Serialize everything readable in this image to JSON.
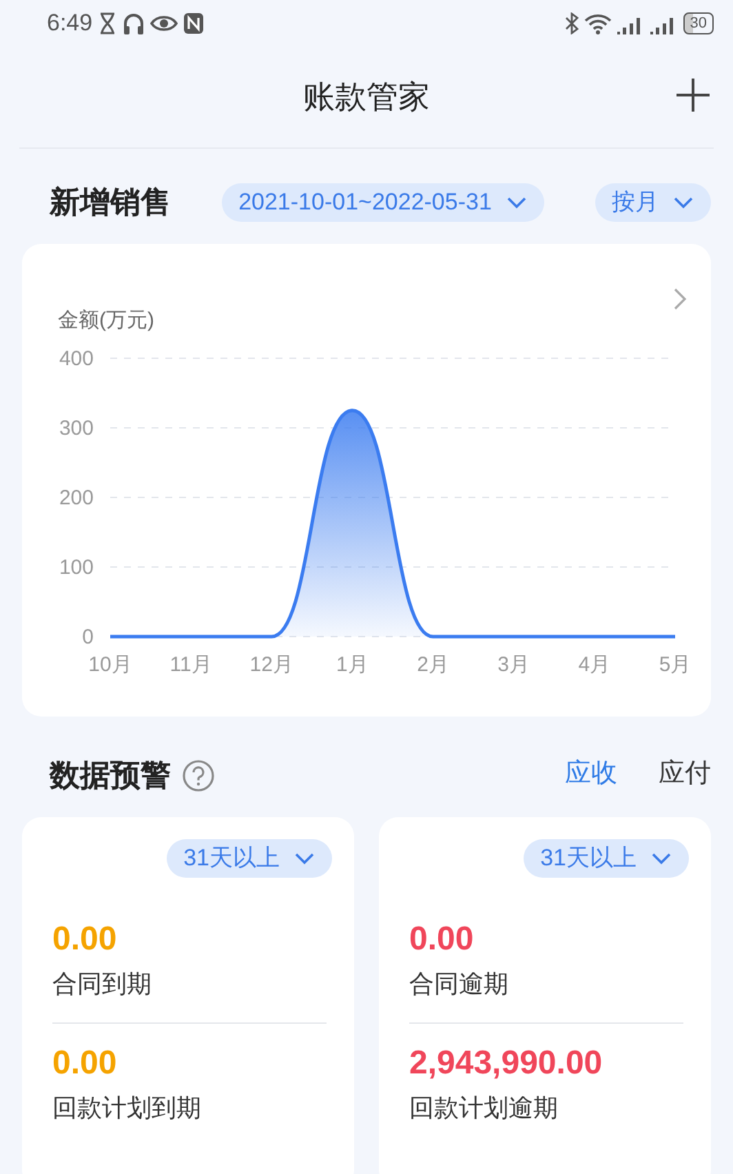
{
  "status_bar": {
    "time": "6:49",
    "battery": "30"
  },
  "header": {
    "title": "账款管家"
  },
  "sales": {
    "title": "新增销售",
    "date_range": "2021-10-01~2022-05-31",
    "period": "按月",
    "chart_data": {
      "type": "area",
      "ylabel": "金额(万元)",
      "categories": [
        "10月",
        "11月",
        "12月",
        "1月",
        "2月",
        "3月",
        "4月",
        "5月"
      ],
      "grid": true,
      "series": [
        {
          "color": "#3b7cf0",
          "values": [
            0,
            0,
            0,
            325,
            0,
            0,
            0,
            0
          ]
        }
      ],
      "ylim": [
        0,
        400
      ],
      "yticks": [
        0,
        100,
        200,
        300,
        400
      ]
    }
  },
  "alerts": {
    "title": "数据预警",
    "tabs": [
      {
        "label": "应收",
        "selected": true
      },
      {
        "label": "应付",
        "selected": false
      }
    ],
    "cards": [
      {
        "filter": "31天以上",
        "items": [
          {
            "value": "0.00",
            "label": "合同到期",
            "color": "#f5a300"
          },
          {
            "value": "0.00",
            "label": "回款计划到期",
            "color": "#f5a300"
          }
        ]
      },
      {
        "filter": "31天以上",
        "items": [
          {
            "value": "0.00",
            "label": "合同逾期",
            "color": "#f0465a"
          },
          {
            "value": "2,943,990.00",
            "label": "回款计划逾期",
            "color": "#f0465a"
          }
        ]
      }
    ]
  }
}
